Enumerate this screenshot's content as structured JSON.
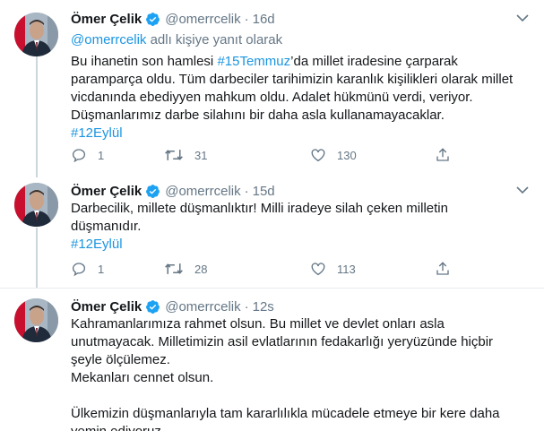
{
  "tweets": [
    {
      "name": "Ömer Çelik",
      "handle": "@omerrcelik",
      "separator": "·",
      "time": "16d",
      "replying_prefix": "@omerrcelik",
      "replying_suffix": " adlı kişiye yanıt olarak",
      "text_1": "Bu ihanetin son hamlesi ",
      "hashtag_inline": "#15Temmuz",
      "text_2": "’da millet iradesine çarparak paramparça oldu. Tüm darbeciler tarihimizin karanlık kişilikleri olarak millet vicdanında ebediyyen mahkum oldu. Adalet hükmünü verdi, veriyor. Düşmanlarımız darbe silahını bir daha asla kullanamayacaklar.",
      "hashtag": "#12Eylül",
      "replies": "1",
      "retweets": "31",
      "likes": "130"
    },
    {
      "name": "Ömer Çelik",
      "handle": "@omerrcelik",
      "separator": "·",
      "time": "15d",
      "text": "Darbecilik, millete düşmanlıktır! Milli iradeye silah çeken milletin düşmanıdır.",
      "hashtag": "#12Eylül",
      "replies": "1",
      "retweets": "28",
      "likes": "113"
    },
    {
      "name": "Ömer Çelik",
      "handle": "@omerrcelik",
      "separator": "·",
      "time": "12s",
      "text": "Kahramanlarımıza rahmet olsun. Bu millet ve devlet onları asla unutmayacak. Milletimizin asil evlatlarının fedakarlığı yeryüzünde hiçbir şeyle ölçülemez.\nMekanları cennet olsun.\n\nÜlkemizin düşmanlarıyla tam kararlılıkla mücadele etmeye bir kere daha yemin ediyoruz."
    }
  ],
  "colors": {
    "link": "#1b95e0",
    "secondary_text": "#657786",
    "verified": "#1da1f2",
    "thread_line": "#ccd6dd"
  }
}
